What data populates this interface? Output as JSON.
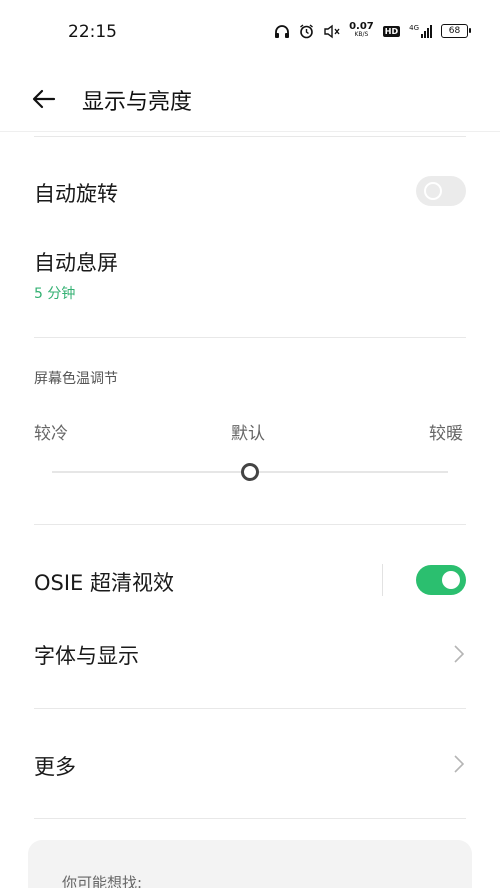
{
  "status_bar": {
    "time": "22:15",
    "net_speed": "0.07",
    "net_unit": "KB/S",
    "hd": "HD",
    "network": "4G",
    "battery": "68"
  },
  "app_bar": {
    "title": "显示与亮度"
  },
  "settings": {
    "auto_rotate": {
      "label": "自动旋转",
      "enabled": false
    },
    "screen_timeout": {
      "label": "自动息屏",
      "value": "5 分钟"
    },
    "color_temp": {
      "section_label": "屏幕色温调节",
      "cool_label": "较冷",
      "default_label": "默认",
      "warm_label": "较暖",
      "level": 0.5
    },
    "osie": {
      "label": "OSIE 超清视效",
      "enabled": true
    },
    "font_display": {
      "label": "字体与显示"
    },
    "more": {
      "label": "更多"
    }
  },
  "suggestions": {
    "title": "你可能想找:"
  },
  "colors": {
    "accent_green": "#2bbf6f",
    "subtitle_green": "#33b072"
  }
}
